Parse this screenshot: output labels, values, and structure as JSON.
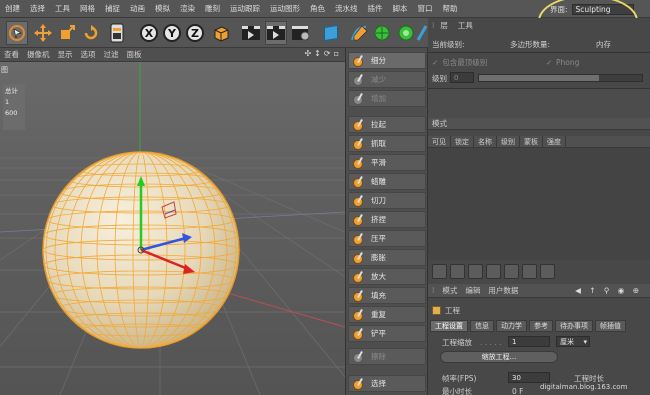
{
  "menubar": {
    "items": [
      "创建",
      "选择",
      "工具",
      "网格",
      "捕捉",
      "动画",
      "模拟",
      "渲染",
      "雕刻",
      "运动跟踪",
      "运动图形",
      "角色",
      "流水线",
      "插件",
      "脚本",
      "窗口",
      "帮助"
    ],
    "layout_label": "界面:",
    "layout_value": "Sculpting"
  },
  "toolbar": {
    "icons": [
      "live-selection-icon",
      "move-icon",
      "scale-icon",
      "rotate-icon",
      "recent-tool-icon",
      "x-axis-lock-icon",
      "y-axis-lock-icon",
      "z-axis-lock-icon",
      "coordinate-system-icon",
      "render-view-icon",
      "render-picture-queue-icon",
      "render-settings-icon",
      "cube-primitive-icon",
      "spline-pen-icon",
      "subdivision-surface-icon",
      "cloner-icon",
      "deformer-icon"
    ],
    "x_label": "X",
    "y_label": "Y",
    "z_label": "Z"
  },
  "viewport": {
    "menu": [
      "查看",
      "摄像机",
      "显示",
      "选项",
      "过滤",
      "面板"
    ],
    "label": "图",
    "stats": {
      "title": "总计",
      "objects": "1",
      "polygons": "600"
    }
  },
  "sculpt_panel": {
    "items": [
      {
        "label": "细分",
        "state": "active"
      },
      {
        "label": "减少",
        "state": "disabled"
      },
      {
        "label": "增加",
        "state": "disabled"
      },
      {
        "label": "拉起",
        "state": "normal"
      },
      {
        "label": "抓取",
        "state": "normal"
      },
      {
        "label": "平滑",
        "state": "normal"
      },
      {
        "label": "蜡雕",
        "state": "normal"
      },
      {
        "label": "切刀",
        "state": "normal"
      },
      {
        "label": "挤捏",
        "state": "normal"
      },
      {
        "label": "压平",
        "state": "normal"
      },
      {
        "label": "膨胀",
        "state": "normal"
      },
      {
        "label": "放大",
        "state": "normal"
      },
      {
        "label": "填充",
        "state": "normal"
      },
      {
        "label": "重复",
        "state": "normal"
      },
      {
        "label": "铲平",
        "state": "normal"
      },
      {
        "label": "擦除",
        "state": "disabled"
      },
      {
        "label": "选择",
        "state": "normal"
      }
    ]
  },
  "right_panel": {
    "header": {
      "tab1": "层",
      "tab2": "工具"
    },
    "current_level_label": "当前级别:",
    "poly_count_label": "多边形数量:",
    "memory_label": "内存",
    "include_tags_label": "包含最顶级别",
    "phong_label": "Phong",
    "level_label": "级别",
    "level_value": "0",
    "mode_label": "模式",
    "columns": [
      "可见",
      "锁定",
      "名称",
      "级别",
      "蒙板",
      "强度"
    ],
    "attr_header": [
      "模式",
      "编辑",
      "用户数据"
    ],
    "project_label": "工程",
    "tabs": [
      "工程设置",
      "信息",
      "动力学",
      "参考",
      "待办事项",
      "帧插值"
    ],
    "project_scale_label": "工程缩放",
    "project_scale_value": "1",
    "project_scale_unit": "厘米",
    "scale_project_button": "缩放工程...",
    "fps_label": "帧率(FPS)",
    "fps_value": "30",
    "project_length_label": "工程时长",
    "min_time_label": "最小时长",
    "min_time_value": "0 F"
  },
  "watermark": "digitalman.blog.163.com",
  "colors": {
    "sphere_fill": "#e9dcc0",
    "sphere_wire": "#f3a937",
    "layout_highlight": "#e8d76a",
    "axis_x": "#d33",
    "axis_y": "#2c2",
    "axis_z": "#35c"
  }
}
